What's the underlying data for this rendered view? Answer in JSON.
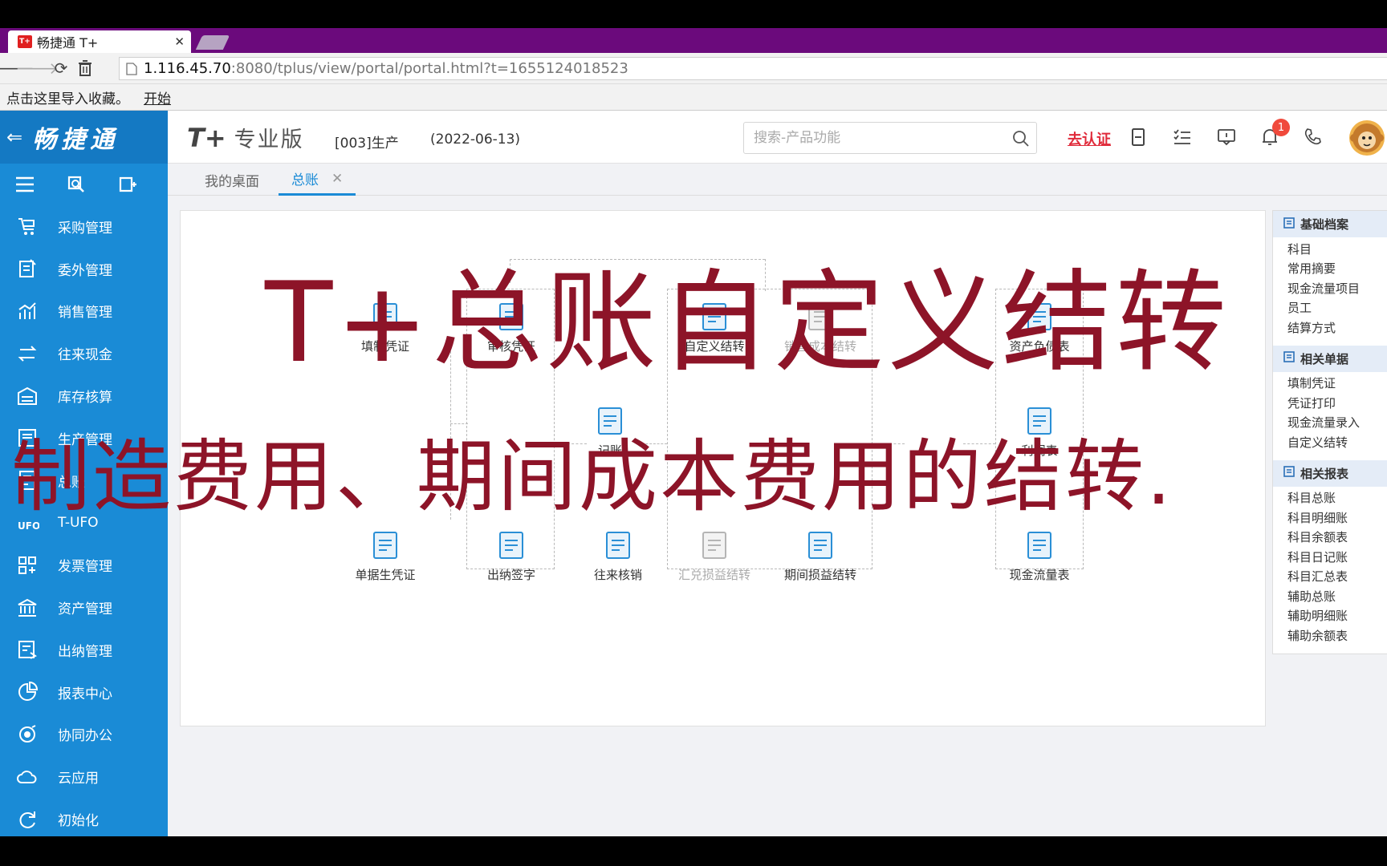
{
  "browser": {
    "tab_title": "畅捷通 T+",
    "tab_favicon_text": "T+",
    "url_host": "1.116.45.70",
    "url_rest": ":8080/tplus/view/portal/portal.html?t=1655124018523",
    "bookmark_hint": "点击这里导入收藏。",
    "bookmark_link": "开始"
  },
  "sidebar": {
    "logo": "畅捷通",
    "items": [
      {
        "label": "采购管理",
        "icon": "cart-icon"
      },
      {
        "label": "委外管理",
        "icon": "outsourcing-icon"
      },
      {
        "label": "销售管理",
        "icon": "sales-chart-icon"
      },
      {
        "label": "往来现金",
        "icon": "exchange-icon"
      },
      {
        "label": "库存核算",
        "icon": "warehouse-icon"
      },
      {
        "label": "生产管理",
        "icon": "production-icon"
      },
      {
        "label": "总账",
        "icon": "ledger-icon"
      },
      {
        "label": "T-UFO",
        "icon": "ufo-icon"
      },
      {
        "label": "发票管理",
        "icon": "invoice-icon"
      },
      {
        "label": "资产管理",
        "icon": "bank-icon"
      },
      {
        "label": "出纳管理",
        "icon": "cashier-icon"
      },
      {
        "label": "报表中心",
        "icon": "pie-chart-icon"
      },
      {
        "label": "协同办公",
        "icon": "collaboration-icon"
      },
      {
        "label": "云应用",
        "icon": "cloud-icon"
      },
      {
        "label": "初始化",
        "icon": "refresh-icon"
      }
    ]
  },
  "header": {
    "brand_t": "T+",
    "brand_edition": "专业版",
    "account": "[003]生产",
    "date": "(2022-06-13)",
    "search_placeholder": "搜索-产品功能",
    "certify": "去认证",
    "notification_count": "1"
  },
  "tabs": {
    "home": "我的桌面",
    "active": "总账"
  },
  "flow": {
    "nodes_row1": [
      "填制凭证",
      "审核凭证",
      "自定义结转",
      "销售成本结转",
      "资产负债表"
    ],
    "nodes_row2": [
      "记账",
      "利润表"
    ],
    "nodes_row3": [
      "单据生凭证",
      "出纳签字",
      "往来核销",
      "汇兑损益结转",
      "期间损益结转",
      "现金流量表"
    ]
  },
  "right_panel": {
    "sections": [
      {
        "title": "基础档案",
        "items": [
          "科目",
          "常用摘要",
          "现金流量项目",
          "员工",
          "结算方式"
        ]
      },
      {
        "title": "相关单据",
        "items": [
          "填制凭证",
          "凭证打印",
          "现金流量录入",
          "自定义结转"
        ]
      },
      {
        "title": "相关报表",
        "items": [
          "科目总账",
          "科目明细账",
          "科目余额表",
          "科目日记账",
          "科目汇总表",
          "辅助总账",
          "辅助明细账",
          "辅助余额表"
        ]
      }
    ]
  },
  "overlay": {
    "title": "T+总账自定义结转",
    "subtitle": "制造费用、期间成本费用的结转."
  },
  "colors": {
    "sidebar": "#1a8bd6",
    "tabbar": "#6b0a7c",
    "overlay_text": "#8d1428",
    "certify": "#e02a3a"
  }
}
